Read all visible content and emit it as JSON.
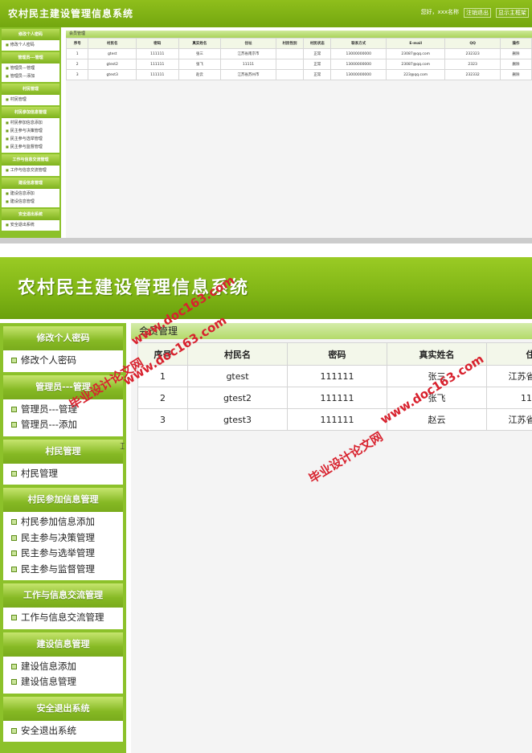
{
  "app_title": "农村民主建设管理信息系统",
  "header": {
    "greeting": "您好，xxx名称",
    "logout_label": "注销退出",
    "home_label": "显示主框架"
  },
  "sidebar": [
    {
      "heading": "修改个人密码",
      "items": [
        "修改个人密码"
      ]
    },
    {
      "heading": "管理员---管理",
      "items": [
        "管理员---管理",
        "管理员---添加"
      ]
    },
    {
      "heading": "村民管理",
      "items": [
        "村民管理"
      ]
    },
    {
      "heading": "村民参加信息管理",
      "items": [
        "村民参加信息添加",
        "民主参与决策管理",
        "民主参与选举管理",
        "民主参与监督管理"
      ]
    },
    {
      "heading": "工作与信息交流管理",
      "items": [
        "工作与信息交流管理"
      ]
    },
    {
      "heading": "建设信息管理",
      "items": [
        "建设信息添加",
        "建设信息管理"
      ]
    },
    {
      "heading": "安全退出系统",
      "items": [
        "安全退出系统"
      ]
    }
  ],
  "panel_title": "会员管理",
  "table": {
    "headers": [
      "序号",
      "村民名",
      "密码",
      "真实姓名",
      "住址",
      "村民性别",
      "村民状态",
      "联系方式",
      "E-mail",
      "QQ",
      "操作"
    ],
    "rows": [
      [
        "1",
        "gtest",
        "111111",
        "张三",
        "江苏省南京市",
        "",
        "正常",
        "13000000000",
        "23087@qq.com",
        "232323",
        "删除"
      ],
      [
        "2",
        "gtest2",
        "111111",
        "张飞",
        "11111",
        "",
        "正常",
        "13000000000",
        "23087@qq.com",
        "2323",
        "删除"
      ],
      [
        "3",
        "gtest3",
        "111111",
        "赵云",
        "江苏省苏州市",
        "",
        "正常",
        "13000000000",
        "223@qq.com",
        "232332",
        "删除"
      ]
    ]
  },
  "watermarks": [
    "www.doc163.com",
    "毕业设计论文网"
  ]
}
